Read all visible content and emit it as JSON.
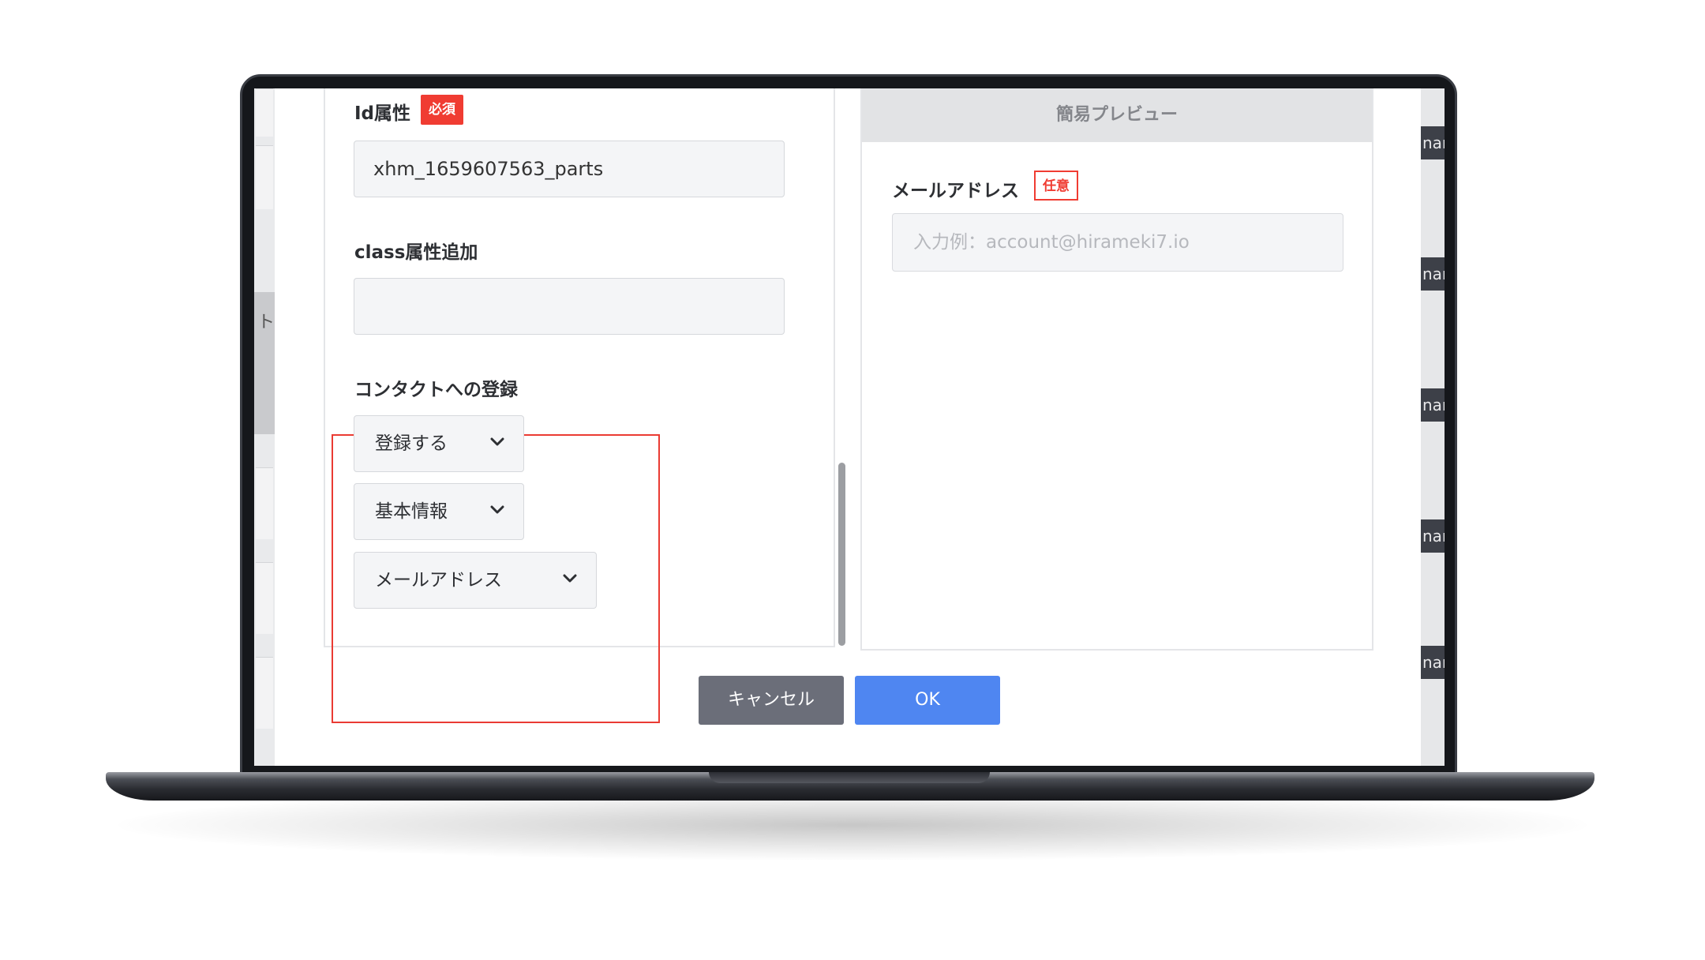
{
  "form": {
    "id_attr_label": "Id属性",
    "required_badge": "必須",
    "id_attr_value": "xhm_1659607563_parts",
    "class_attr_label": "class属性追加",
    "class_attr_value": "",
    "contact_section_label": "コンタクトへの登録",
    "register_select": "登録する",
    "category_select": "基本情報",
    "field_select": "メールアドレス"
  },
  "preview": {
    "header": "簡易プレビュー",
    "field_label": "メールアドレス",
    "optional_badge": "任意",
    "placeholder": "入力例：account@hirameki7.io"
  },
  "buttons": {
    "cancel": "キャンセル",
    "ok": "OK"
  },
  "background": {
    "left_char": "ト",
    "right_tag_text": "nar"
  },
  "colors": {
    "required_red": "#f03c32",
    "highlight_red": "#ea3b33",
    "ok_blue": "#4f86f1",
    "cancel_gray": "#6b6e79"
  },
  "icons": {
    "dropdown": "chevron-down-icon"
  }
}
